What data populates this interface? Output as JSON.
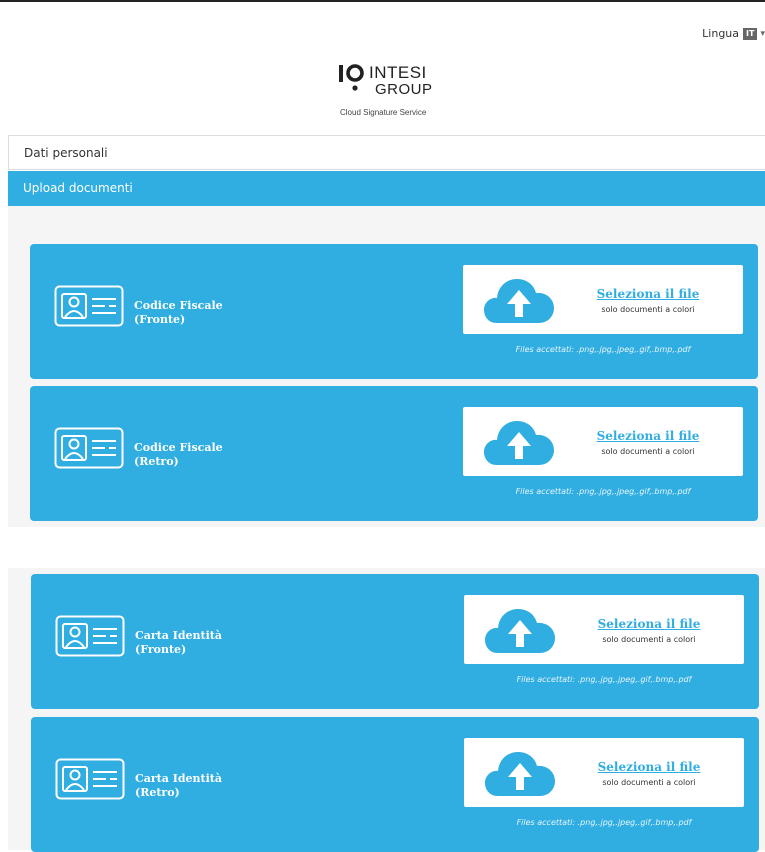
{
  "header": {
    "language_label": "Lingua",
    "language_code": "IT"
  },
  "logo": {
    "mark": "IO",
    "word1": "INTESI",
    "word2": "GROUP",
    "tagline": "Cloud Signature Service"
  },
  "panels": {
    "personal_data": "Dati personali",
    "upload_documents": "Upload documenti"
  },
  "documents": [
    {
      "title_line1": "Codice Fiscale",
      "title_line2": "(Fronte)",
      "select_label": "Seleziona il file",
      "note": "solo documenti a colori",
      "accepted": "Files accettati: .png,.jpg,.jpeg,.gif,.bmp,.pdf"
    },
    {
      "title_line1": "Codice Fiscale",
      "title_line2": "(Retro)",
      "select_label": "Seleziona il file",
      "note": "solo documenti a colori",
      "accepted": "Files accettati: .png,.jpg,.jpeg,.gif,.bmp,.pdf"
    },
    {
      "title_line1": "Carta Identità",
      "title_line2": "(Fronte)",
      "select_label": "Seleziona il file",
      "note": "solo documenti a colori",
      "accepted": "Files accettati: .png,.jpg,.jpeg,.gif,.bmp,.pdf"
    },
    {
      "title_line1": "Carta Identità",
      "title_line2": "(Retro)",
      "select_label": "Seleziona il file",
      "note": "solo documenti a colori",
      "accepted": "Files accettati: .png,.jpg,.jpeg,.gif,.bmp,.pdf"
    }
  ],
  "colors": {
    "accent": "#30ade1",
    "panel_background": "#f5f5f5"
  },
  "icons": {
    "id_card": "id-card-icon",
    "upload": "cloud-upload-icon"
  }
}
